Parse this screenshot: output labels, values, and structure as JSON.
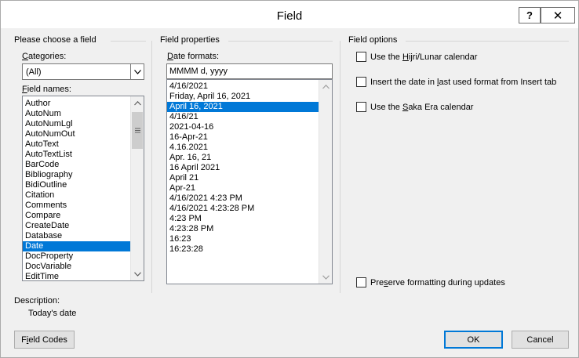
{
  "window": {
    "title": "Field",
    "help_label": "?",
    "close_label": "✕"
  },
  "left": {
    "group_title": "Please choose a field",
    "categories_label_pre": "",
    "categories_label_key": "C",
    "categories_label_post": "ategories:",
    "categories_value": "(All)",
    "field_names_label_key": "F",
    "field_names_label_post": "ield names:",
    "field_names": [
      "Author",
      "AutoNum",
      "AutoNumLgl",
      "AutoNumOut",
      "AutoText",
      "AutoTextList",
      "BarCode",
      "Bibliography",
      "BidiOutline",
      "Citation",
      "Comments",
      "Compare",
      "CreateDate",
      "Database",
      "Date",
      "DocProperty",
      "DocVariable",
      "EditTime"
    ],
    "selected_field": "Date",
    "description_label": "Description:",
    "description_text": "Today's date",
    "field_codes_key": "i",
    "field_codes_pre": "F",
    "field_codes_post": "eld Codes"
  },
  "middle": {
    "group_title": "Field properties",
    "date_formats_key": "D",
    "date_formats_post": "ate formats:",
    "format_input_value": "MMMM d, yyyy",
    "formats": [
      "4/16/2021",
      "Friday, April 16, 2021",
      "April 16, 2021",
      "4/16/21",
      "2021-04-16",
      "16-Apr-21",
      "4.16.2021",
      "Apr. 16, 21",
      "16 April 2021",
      "April 21",
      "Apr-21",
      "4/16/2021 4:23 PM",
      "4/16/2021 4:23:28 PM",
      "4:23 PM",
      "4:23:28 PM",
      "16:23",
      "16:23:28"
    ],
    "selected_format": "April 16, 2021"
  },
  "right": {
    "group_title": "Field options",
    "options": [
      {
        "pre": "Use the ",
        "key": "H",
        "post": "ijri/Lunar calendar"
      },
      {
        "pre": "Insert the date in ",
        "key": "l",
        "post": "ast used format from Insert tab"
      },
      {
        "pre": "Use the ",
        "key": "S",
        "post": "aka Era calendar"
      }
    ],
    "preserve": {
      "pre": "Pre",
      "key": "s",
      "post": "erve formatting during updates"
    }
  },
  "buttons": {
    "ok": "OK",
    "cancel": "Cancel"
  },
  "colors": {
    "selection": "#0078d7",
    "dialog_bg": "#f0f0f0"
  }
}
